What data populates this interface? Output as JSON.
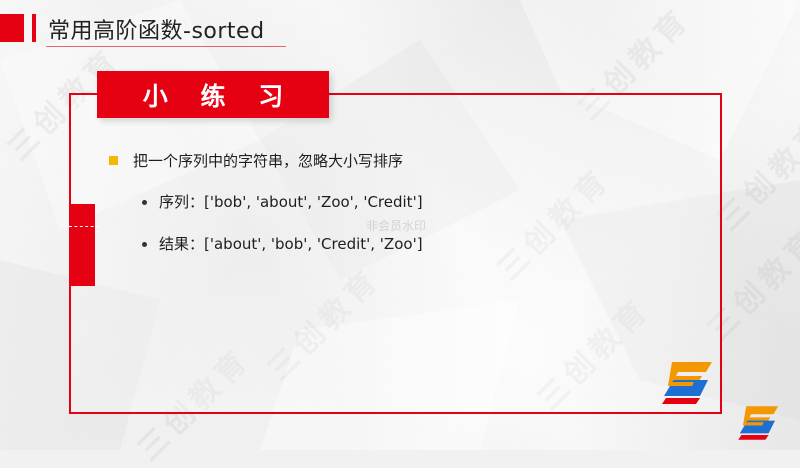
{
  "header": {
    "title": "常用高阶函数-sorted"
  },
  "banner": {
    "label": "小 练 习"
  },
  "content": {
    "main": "把一个序列中的字符串，忽略大小写排序",
    "items": [
      "序列：['bob', 'about', 'Zoo', 'Credit']",
      "结果：['about', 'bob', 'Credit', 'Zoo']"
    ]
  },
  "faint_text": "非会员水印",
  "watermark": "三创教育",
  "colors": {
    "accent": "#e50012",
    "bullet": "#f5b800",
    "logo_orange": "#f39800",
    "logo_blue": "#1d6fd1",
    "logo_red": "#e50012"
  },
  "icons": {
    "logo": "sanchuang-s-logo-icon"
  }
}
